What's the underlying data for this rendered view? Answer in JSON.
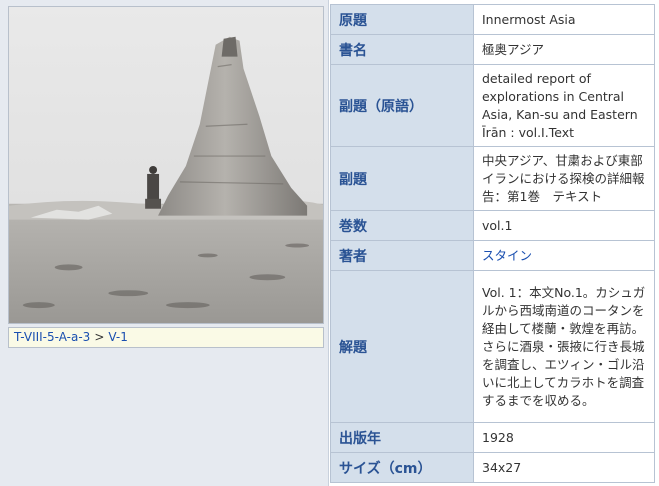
{
  "caption": {
    "path_link": "T-VIII-5-A-a-3",
    "separator": ">",
    "item_link": "V-1"
  },
  "metadata": [
    {
      "label": "原題",
      "value": "Innermost Asia"
    },
    {
      "label": "書名",
      "value": "極奥アジア"
    },
    {
      "label": "副題（原語）",
      "value": "detailed report of explorations in Central Asia, Kan-su and Eastern Īrān : vol.I.Text"
    },
    {
      "label": "副題",
      "value": "中央アジア、甘粛および東部イランにおける探検の詳細報告：第1巻　テキスト"
    },
    {
      "label": "巻数",
      "value": "vol.1"
    },
    {
      "label": "著者",
      "value": "スタイン"
    },
    {
      "label": "解題",
      "value": "Vol. 1：本文No.1。カシュガルから西域南道のコータンを経由して楼蘭・敦煌を再訪。さらに酒泉・張掖に行き長城を調査し、エツィン・ゴル沿いに北上してカラホトを調査するまでを収める。"
    },
    {
      "label": "出版年",
      "value": "1928"
    },
    {
      "label": "サイズ（cm）",
      "value": "34x27"
    }
  ]
}
